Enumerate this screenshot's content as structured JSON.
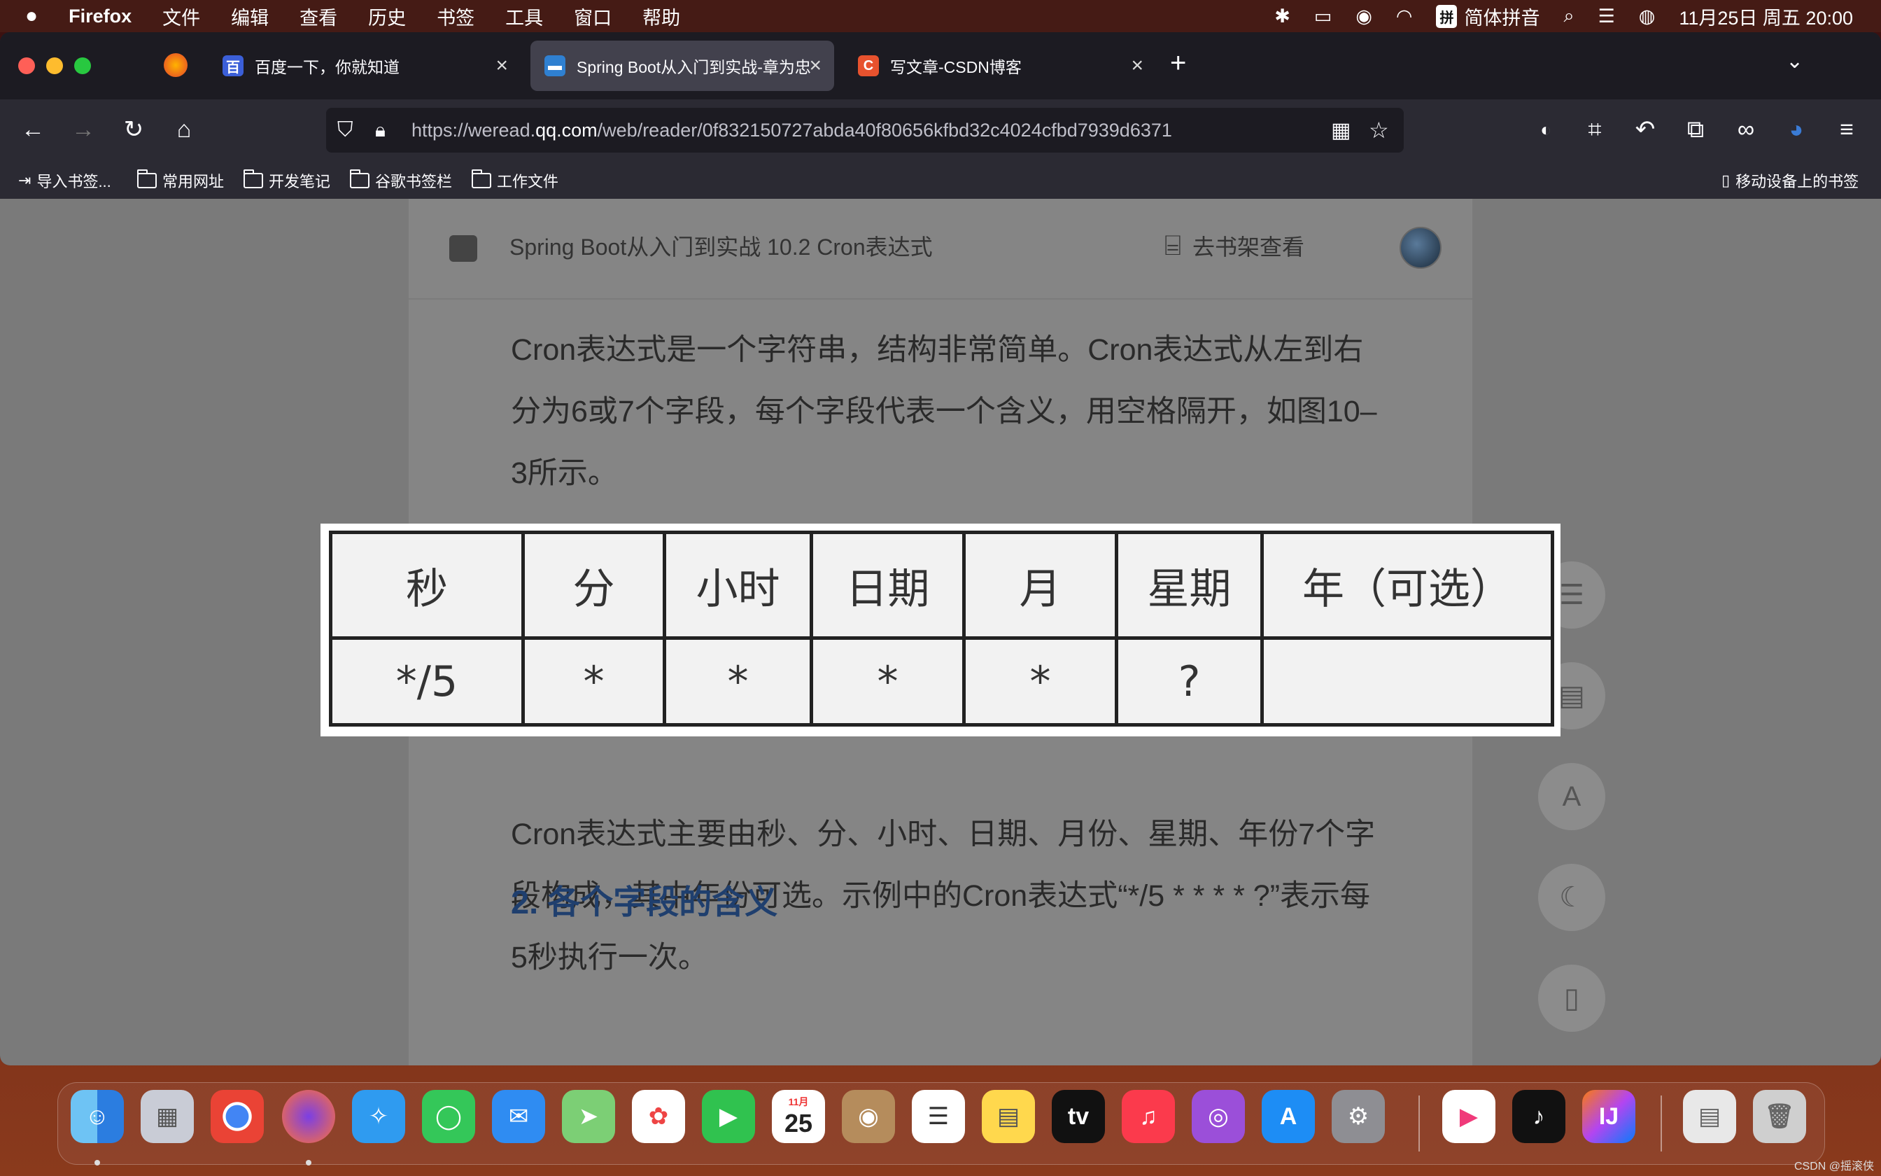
{
  "menubar": {
    "app": "Firefox",
    "menus": [
      "文件",
      "编辑",
      "查看",
      "历史",
      "书签",
      "工具",
      "窗口",
      "帮助"
    ],
    "ime_box": "拼",
    "ime_label": "简体拼音",
    "datetime": "11月25日 周五  20:00"
  },
  "tabs": [
    {
      "title": "百度一下，你就知道",
      "icon": "baidu-icon"
    },
    {
      "title": "Spring Boot从入门到实战-章为忠",
      "icon": "weread-icon"
    },
    {
      "title": "写文章-CSDN博客",
      "icon": "csdn-icon"
    }
  ],
  "urlbar": {
    "url_prefix": "https://weread.",
    "url_domain": "qq.com",
    "url_suffix": "/web/reader/0f832150727abda40f80656kfbd32c4024cfbd7939d6371"
  },
  "bookmarks": {
    "import": "导入书签...",
    "folders": [
      "常用网址",
      "开发笔记",
      "谷歌书签栏",
      "工作文件"
    ],
    "mobile": "移动设备上的书签"
  },
  "reader": {
    "header_title": "Spring Boot从入门到实战 10.2 Cron表达式",
    "shelf_label": "去书架查看",
    "para1": "Cron表达式是一个字符串，结构非常简单。Cron表达式从左到右分为6或7个字段，每个字段代表一个含义，用空格隔开，如图10–3所示。",
    "para2": "Cron表达式主要由秒、分、小时、日期、月份、星期、年份7个字段构成，其中年份可选。示例中的Cron表达式“*/5 * * * * ?”表示每5秒执行一次。",
    "heading": "2. 各个字段的含义"
  },
  "cron_table": {
    "headers": [
      "秒",
      "分",
      "小时",
      "日期",
      "月",
      "星期",
      "年（可选）"
    ],
    "values": [
      "*/5",
      "*",
      "*",
      "*",
      "*",
      "?",
      ""
    ]
  },
  "side_buttons": [
    "A"
  ],
  "dock_calendar": {
    "month": "11月",
    "day": "25"
  },
  "watermark": "CSDN @摇滚侠"
}
